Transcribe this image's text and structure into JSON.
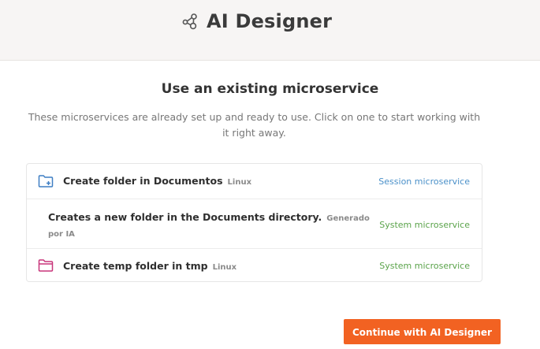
{
  "header": {
    "title": "AI Designer",
    "logo_icon": "ai-nodes-icon"
  },
  "main": {
    "title": "Use an existing microservice",
    "description": "These microservices are already set up and ready to use. Click on one to start working with it right away.",
    "microservices": [
      {
        "title": "Create folder in Documentos",
        "tag": "Linux",
        "type": "Session microservice",
        "icon": "folder-plus-icon"
      },
      {
        "title": "Creates a new folder in the Documents directory.",
        "tag": "Generado por IA",
        "type": "System microservice",
        "icon": ""
      },
      {
        "title": "Create temp folder in tmp",
        "tag": "Linux",
        "type": "System microservice",
        "icon": "folder-icon"
      }
    ],
    "continue_label": "Continue with AI Designer"
  },
  "colors": {
    "accent": "#f26222",
    "session_type": "#4a90c9",
    "system_type": "#5aa34a",
    "folder_blue": "#3f7fc4",
    "folder_pink": "#c8357a"
  }
}
